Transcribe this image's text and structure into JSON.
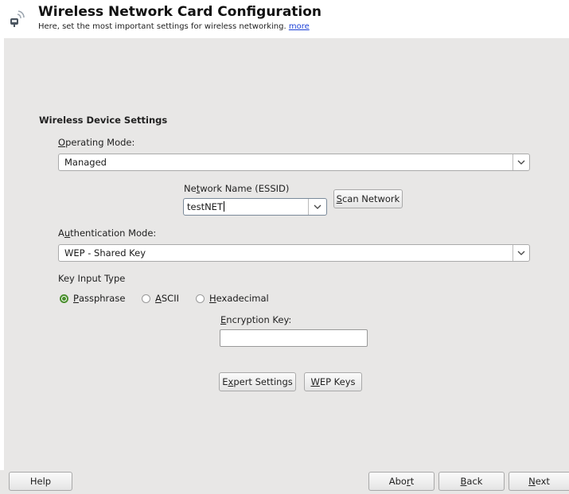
{
  "header": {
    "title": "Wireless Network Card Configuration",
    "subtitle": "Here, set the most important settings for wireless networking.",
    "more_link": "more",
    "icon": "wireless-network-icon"
  },
  "section": {
    "title": "Wireless Device Settings"
  },
  "operating_mode": {
    "label_u": "O",
    "label_rest": "perating Mode:",
    "value": "Managed"
  },
  "network_name": {
    "label_pre": "Ne",
    "label_u": "t",
    "label_post": "work Name (ESSID)",
    "value": "testNET"
  },
  "scan_button": {
    "u": "S",
    "rest": "can Network"
  },
  "authentication_mode": {
    "label_pre": "A",
    "label_u": "u",
    "label_post": "thentication Mode:",
    "value": "WEP - Shared Key"
  },
  "key_input_type": {
    "label": "Key Input Type",
    "options": [
      {
        "u": "P",
        "rest": "assphrase",
        "selected": true
      },
      {
        "u": "A",
        "rest": "SCII",
        "selected": false
      },
      {
        "u": "H",
        "rest": "exadecimal",
        "selected": false
      }
    ]
  },
  "encryption_key": {
    "label_u": "E",
    "label_rest": "ncryption Key:",
    "value": ""
  },
  "buttons": {
    "expert_pre": "E",
    "expert_u": "x",
    "expert_post": "pert Settings",
    "wep_u": "W",
    "wep_rest": "EP Keys"
  },
  "footer": {
    "help": "Help",
    "abort_pre": "Abo",
    "abort_u": "r",
    "abort_post": "t",
    "back_u": "B",
    "back_rest": "ack",
    "next_u": "N",
    "next_rest": "ext"
  },
  "colors": {
    "panel_bg": "#e8e7e6",
    "radio_selected": "#4a8f2e",
    "link": "#1a3fd6"
  }
}
